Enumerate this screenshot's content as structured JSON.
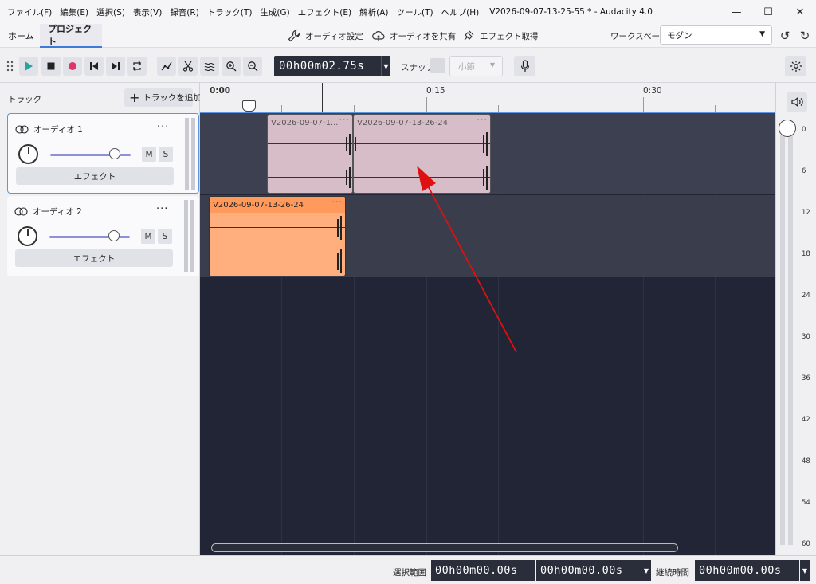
{
  "menu": [
    "ファイル(F)",
    "編集(E)",
    "選択(S)",
    "表示(V)",
    "録音(R)",
    "トラック(T)",
    "生成(G)",
    "エフェクト(E)",
    "解析(A)",
    "ツール(T)",
    "ヘルプ(H)"
  ],
  "window_title": "V2026-09-07-13-25-55 * - Audacity 4.0",
  "tabs": {
    "home": "ホーム",
    "project": "プロジェクト"
  },
  "header": {
    "audio_settings": "オーディオ設定",
    "share_audio": "オーディオを共有",
    "get_effects": "エフェクト取得",
    "workspace_label": "ワークスペース",
    "workspace_value": "モダン"
  },
  "toolbar": {
    "time": "00h00m02.75s",
    "snap_label": "スナップ",
    "snap_value": "小節"
  },
  "track_panel": {
    "title": "トラック",
    "add_track": "トラックを追加",
    "tracks": [
      {
        "name": "オーディオ 1",
        "mute": "M",
        "solo": "S",
        "effects": "エフェクト",
        "selected": true
      },
      {
        "name": "オーディオ 2",
        "mute": "M",
        "solo": "S",
        "effects": "エフェクト",
        "selected": false
      }
    ]
  },
  "ruler": {
    "labels": [
      "0:00",
      "0:15",
      "0:30"
    ]
  },
  "clips": [
    {
      "name": "V2026-09-07-1...",
      "track": 1,
      "color": "#d6bdc7"
    },
    {
      "name": "V2026-09-07-13-26-24",
      "track": 1,
      "color": "#d6bdc7"
    },
    {
      "name": "V2026-09-07-13-26-24",
      "track": 2,
      "color": "#ffae7e"
    }
  ],
  "meter": {
    "db_labels": [
      "0",
      "6",
      "12",
      "18",
      "24",
      "30",
      "36",
      "42",
      "48",
      "54",
      "60"
    ]
  },
  "status": {
    "selection_label": "選択範囲",
    "sel_start": "00h00m00.00s",
    "sel_end": "00h00m00.00s",
    "duration_label": "継続時間",
    "duration": "00h00m00.00s"
  },
  "annotation": {
    "arrow_color": "#e01010"
  }
}
